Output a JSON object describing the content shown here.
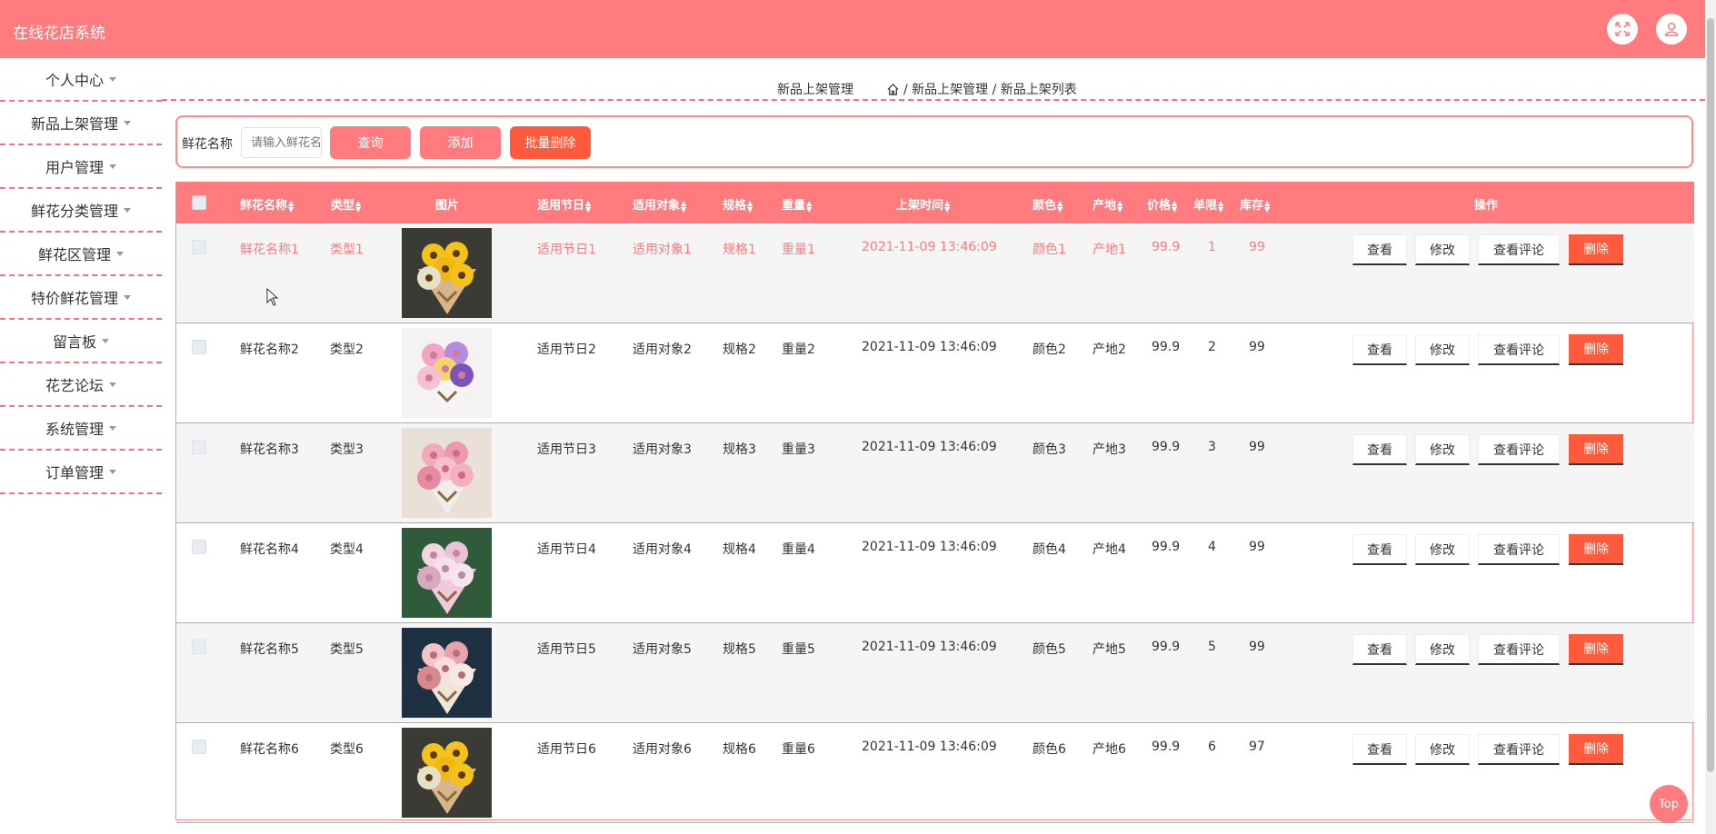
{
  "app": {
    "title": "在线花店系统"
  },
  "sidebar": {
    "items": [
      {
        "label": "个人中心"
      },
      {
        "label": "新品上架管理"
      },
      {
        "label": "用户管理"
      },
      {
        "label": "鲜花分类管理"
      },
      {
        "label": "鲜花区管理"
      },
      {
        "label": "特价鲜花管理"
      },
      {
        "label": "留言板"
      },
      {
        "label": "花艺论坛"
      },
      {
        "label": "系统管理"
      },
      {
        "label": "订单管理"
      }
    ]
  },
  "breadcrumb": {
    "title": "新品上架管理",
    "path": "/ 新品上架管理 / 新品上架列表"
  },
  "search": {
    "label": "鲜花名称",
    "placeholder": "请输入鲜花名称",
    "query": "查询",
    "add": "添加",
    "batch_delete": "批量删除"
  },
  "table": {
    "headers": [
      "鲜花名称",
      "类型",
      "图片",
      "适用节日",
      "适用对象",
      "规格",
      "重量",
      "上架时间",
      "颜色",
      "产地",
      "价格",
      "单限",
      "库存",
      "操作"
    ],
    "actions": {
      "view": "查看",
      "edit": "修改",
      "comments": "查看评论",
      "delete": "删除"
    },
    "rows": [
      {
        "name": "鲜花名称1",
        "type": "类型1",
        "holiday": "适用节日1",
        "target": "适用对象1",
        "spec": "规格1",
        "weight": "重量1",
        "time": "2021-11-09 13:46:09",
        "color": "颜色1",
        "origin": "产地1",
        "price": "99.9",
        "limit": "1",
        "stock": "99",
        "image": "sunflower-bouquet"
      },
      {
        "name": "鲜花名称2",
        "type": "类型2",
        "holiday": "适用节日2",
        "target": "适用对象2",
        "spec": "规格2",
        "weight": "重量2",
        "time": "2021-11-09 13:46:09",
        "color": "颜色2",
        "origin": "产地2",
        "price": "99.9",
        "limit": "2",
        "stock": "99",
        "image": "mixed-vase-bouquet"
      },
      {
        "name": "鲜花名称3",
        "type": "类型3",
        "holiday": "适用节日3",
        "target": "适用对象3",
        "spec": "规格3",
        "weight": "重量3",
        "time": "2021-11-09 13:46:09",
        "color": "颜色3",
        "origin": "产地3",
        "price": "99.9",
        "limit": "3",
        "stock": "99",
        "image": "pink-vase-bouquet"
      },
      {
        "name": "鲜花名称4",
        "type": "类型4",
        "holiday": "适用节日4",
        "target": "适用对象4",
        "spec": "规格4",
        "weight": "重量4",
        "time": "2021-11-09 13:46:09",
        "color": "颜色4",
        "origin": "产地4",
        "price": "99.9",
        "limit": "4",
        "stock": "99",
        "image": "pink-wrapped-bouquet"
      },
      {
        "name": "鲜花名称5",
        "type": "类型5",
        "holiday": "适用节日5",
        "target": "适用对象5",
        "spec": "规格5",
        "weight": "重量5",
        "time": "2021-11-09 13:46:09",
        "color": "颜色5",
        "origin": "产地5",
        "price": "99.9",
        "limit": "5",
        "stock": "99",
        "image": "rose-paper-bouquet"
      },
      {
        "name": "鲜花名称6",
        "type": "类型6",
        "holiday": "适用节日6",
        "target": "适用对象6",
        "spec": "规格6",
        "weight": "重量6",
        "time": "2021-11-09 13:46:09",
        "color": "颜色6",
        "origin": "产地6",
        "price": "99.9",
        "limit": "6",
        "stock": "97",
        "image": "sunflower-bouquet"
      }
    ]
  },
  "top_button": "Top",
  "colors": {
    "primary": "#ff7b7e",
    "danger": "#ff5a3c",
    "highlight_text": "#ff7b7e"
  }
}
